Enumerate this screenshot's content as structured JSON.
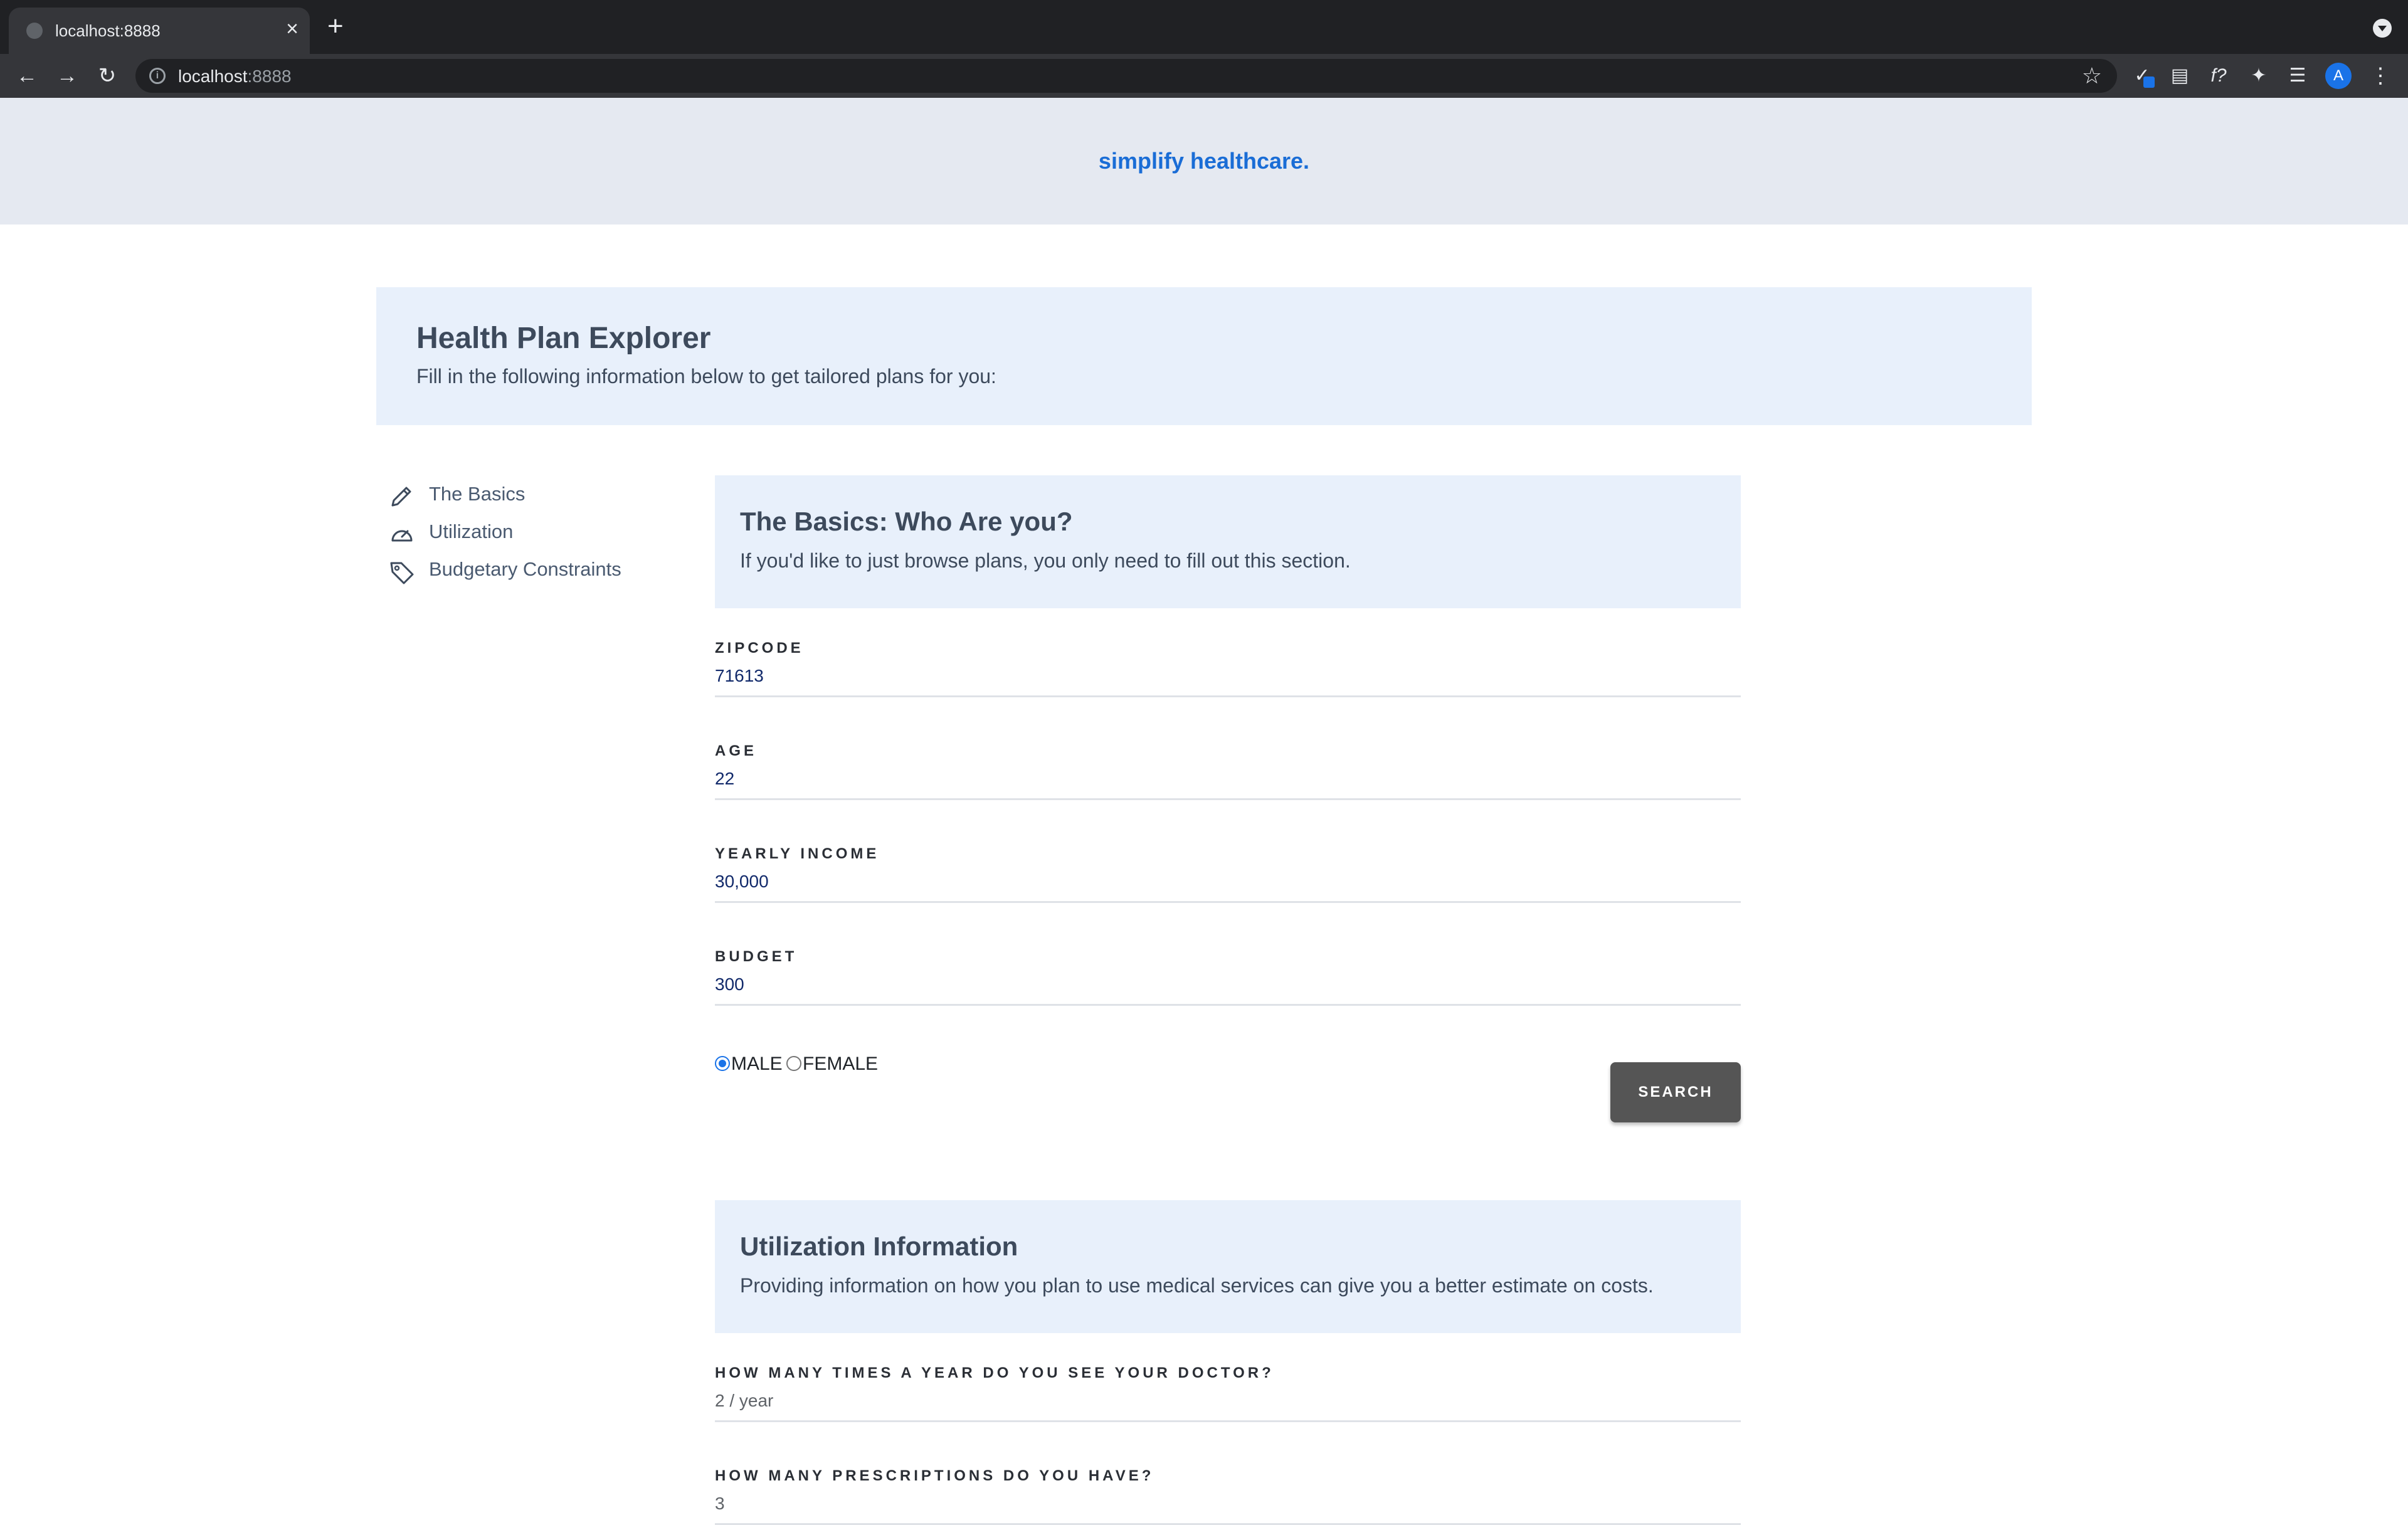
{
  "browser": {
    "tab_title": "localhost:8888",
    "tab_close": "×",
    "new_tab": "+",
    "url_host": "localhost",
    "url_port": ":8888",
    "avatar_initial": "A"
  },
  "site": {
    "brand": "simplify healthcare."
  },
  "hero": {
    "title": "Health Plan Explorer",
    "subtitle": "Fill in the following information below to get tailored plans for you:"
  },
  "sidenav": {
    "items": [
      {
        "label": "The Basics",
        "icon": "pencil-icon"
      },
      {
        "label": "Utilization",
        "icon": "gauge-icon"
      },
      {
        "label": "Budgetary Constraints",
        "icon": "tag-icon"
      }
    ]
  },
  "basics": {
    "title": "The Basics: Who Are you?",
    "subtitle": "If you'd like to just browse plans, you only need to fill out this section.",
    "fields": {
      "zipcode": {
        "label": "ZIPCODE",
        "value": "71613"
      },
      "age": {
        "label": "AGE",
        "value": "22"
      },
      "income": {
        "label": "YEARLY INCOME",
        "value": "30,000"
      },
      "budget": {
        "label": "BUDGET",
        "value": "300"
      }
    },
    "gender": {
      "options": [
        "MALE",
        "FEMALE"
      ],
      "selected": "MALE"
    },
    "search_label": "SEARCH"
  },
  "utilization": {
    "title": "Utilization Information",
    "subtitle": "Providing information on how you plan to use medical services can give you a better estimate on costs.",
    "fields": {
      "doctor": {
        "label": "HOW MANY TIMES A YEAR DO YOU SEE YOUR DOCTOR?",
        "value": "2 / year"
      },
      "prescriptions": {
        "label": "HOW MANY PRESCRIPTIONS DO YOU HAVE?",
        "value": "3"
      }
    }
  },
  "colors": {
    "brand": "#1a6dd6",
    "card_bg": "#e8f0fb",
    "header_bg": "#e5e9f1",
    "button_bg": "#555555"
  }
}
